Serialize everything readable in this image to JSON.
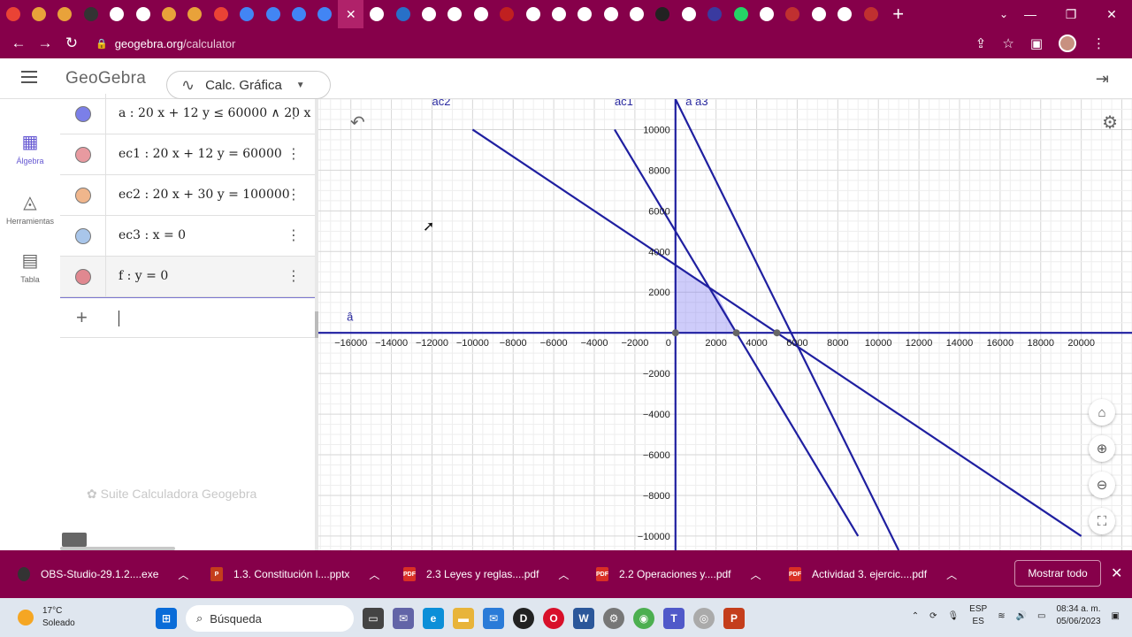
{
  "browser": {
    "tab_count": 34,
    "tab_colors": [
      "#ea4335",
      "#e8a23a",
      "#e8a23a",
      "#333",
      "#fff",
      "#fff",
      "#e8a23a",
      "#e8a23a",
      "#ea4335",
      "#4285f4",
      "#4285f4",
      "#4285f4",
      "#4285f4",
      "#b0226a",
      "#fff",
      "#2870c8",
      "#fff",
      "#fff",
      "#fff",
      "#c02020",
      "#fff",
      "#fff",
      "#fff",
      "#fff",
      "#fff",
      "#222",
      "#fff",
      "#3a3aa0",
      "#25d366",
      "#fff",
      "#c03030",
      "#fff",
      "#fff",
      "#c03030"
    ],
    "active_tab_index": 13,
    "active_tab_label": "✕",
    "new_tab_label": "+",
    "url_host": "geogebra.org",
    "url_path": "/calculator",
    "accent_color": "#86004a"
  },
  "app": {
    "logo": "GeoGebra",
    "app_select_label": "Calc. Gráfica",
    "nav": [
      {
        "label": "Álgebra",
        "icon": "calculator-icon",
        "active": true
      },
      {
        "label": "Herramientas",
        "icon": "shapes-icon",
        "active": false
      },
      {
        "label": "Tabla",
        "icon": "table-icon",
        "active": false
      }
    ]
  },
  "algebra": {
    "rows": [
      {
        "expr": "a : 20 x + 12 y ≤ 60000 ∧ 20 x + 30 y ≤ 100000",
        "color": "#7b7fe8",
        "selected": false
      },
      {
        "expr": "ec1 : 20 x + 12 y = 60000",
        "color": "#e89aa0",
        "selected": false
      },
      {
        "expr": "ec2 : 20 x + 30 y = 100000",
        "color": "#f0b68c",
        "selected": false
      },
      {
        "expr": "ec3 : x = 0",
        "color": "#a9c6ea",
        "selected": false
      },
      {
        "expr": "f : y = 0",
        "color": "#e08890",
        "selected": true
      }
    ],
    "input_placeholder": "",
    "suite_label": "Suite Calculadora Geogebra"
  },
  "chart_data": {
    "type": "line",
    "xlim": [
      -17600,
      22500
    ],
    "ylim": [
      -10700,
      11500
    ],
    "grid": true,
    "x_ticks": [
      -16000,
      -14000,
      -12000,
      -10000,
      -8000,
      -6000,
      -4000,
      -2000,
      0,
      2000,
      4000,
      6000,
      8000,
      10000,
      12000,
      14000,
      16000,
      18000,
      20000
    ],
    "y_ticks": [
      -10000,
      -8000,
      -6000,
      -4000,
      -2000,
      2000,
      4000,
      6000,
      8000,
      10000
    ],
    "series": [
      {
        "name": "ec1",
        "equation": "20x + 12y = 60000",
        "points": [
          [
            -3000,
            10000
          ],
          [
            9000,
            -10000
          ]
        ]
      },
      {
        "name": "ec2",
        "equation": "20x + 30y = 100000",
        "points": [
          [
            -10000,
            10000
          ],
          [
            20000,
            -10000
          ]
        ]
      },
      {
        "name": "a3",
        "equation": "boundary",
        "points": [
          [
            0,
            11500
          ],
          [
            11000,
            -10700
          ]
        ]
      },
      {
        "name": "ec3",
        "equation": "x = 0",
        "points": [
          [
            0,
            -10700
          ],
          [
            0,
            11500
          ]
        ]
      },
      {
        "name": "f",
        "equation": "y = 0",
        "points": [
          [
            -17600,
            0
          ],
          [
            22500,
            0
          ]
        ]
      }
    ],
    "feasible_region": [
      [
        0,
        0
      ],
      [
        3000,
        0
      ],
      [
        2000,
        2000
      ],
      [
        0,
        3333
      ]
    ],
    "vertices": [
      [
        0,
        0
      ],
      [
        3000,
        0
      ],
      [
        5000,
        0
      ]
    ],
    "line_labels": [
      {
        "text": "ac2",
        "x": -12000,
        "y": 11200
      },
      {
        "text": "ac1",
        "x": -3000,
        "y": 11200
      },
      {
        "text": "a a3",
        "x": 500,
        "y": 11200
      },
      {
        "text": "â",
        "x": -16200,
        "y": 600
      }
    ]
  },
  "downloads": {
    "items": [
      {
        "label": "OBS-Studio-29.1.2....exe",
        "kind": "exe"
      },
      {
        "label": "1.3. Constitución l....pptx",
        "kind": "pptx"
      },
      {
        "label": "2.3 Leyes y reglas....pdf",
        "kind": "pdf"
      },
      {
        "label": "2.2 Operaciones y....pdf",
        "kind": "pdf"
      },
      {
        "label": "Actividad 3. ejercic....pdf",
        "kind": "pdf"
      }
    ],
    "show_all_label": "Mostrar todo"
  },
  "taskbar": {
    "temp": "17°C",
    "weather": "Soleado",
    "search_label": "Búsqueda",
    "lang1": "ESP",
    "lang2": "ES",
    "time": "08:34 a. m.",
    "date": "05/06/2023"
  }
}
